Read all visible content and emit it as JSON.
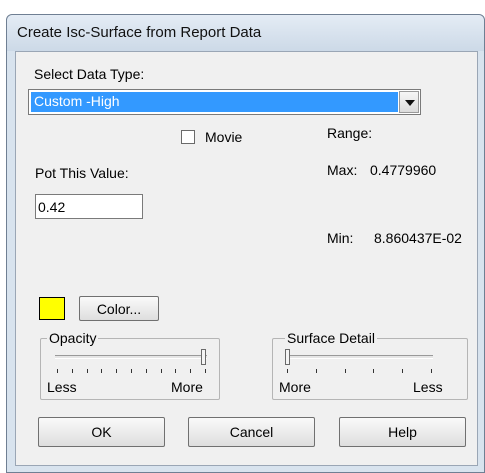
{
  "window": {
    "title": "Create Isc-Surface from Report Data"
  },
  "data_type": {
    "label": "Select Data Type:",
    "selected": "Custom -High"
  },
  "movie": {
    "label": "Movie",
    "checked": false
  },
  "range": {
    "label": "Range:",
    "max_label": "Max:",
    "max_value": "0.4779960",
    "min_label": "Min:",
    "min_value": "8.860437E-02"
  },
  "plot_value": {
    "label": "Pot This Value:",
    "value": "0.42"
  },
  "color": {
    "button_label": "Color...",
    "swatch_color": "#ffff00"
  },
  "opacity": {
    "title": "Opacity",
    "left_label": "Less",
    "right_label": "More",
    "level": 1.0
  },
  "surface_detail": {
    "title": "Surface Detail",
    "left_label": "More",
    "right_label": "Less",
    "level": 0.0
  },
  "buttons": {
    "ok": "OK",
    "cancel": "Cancel",
    "help": "Help"
  }
}
